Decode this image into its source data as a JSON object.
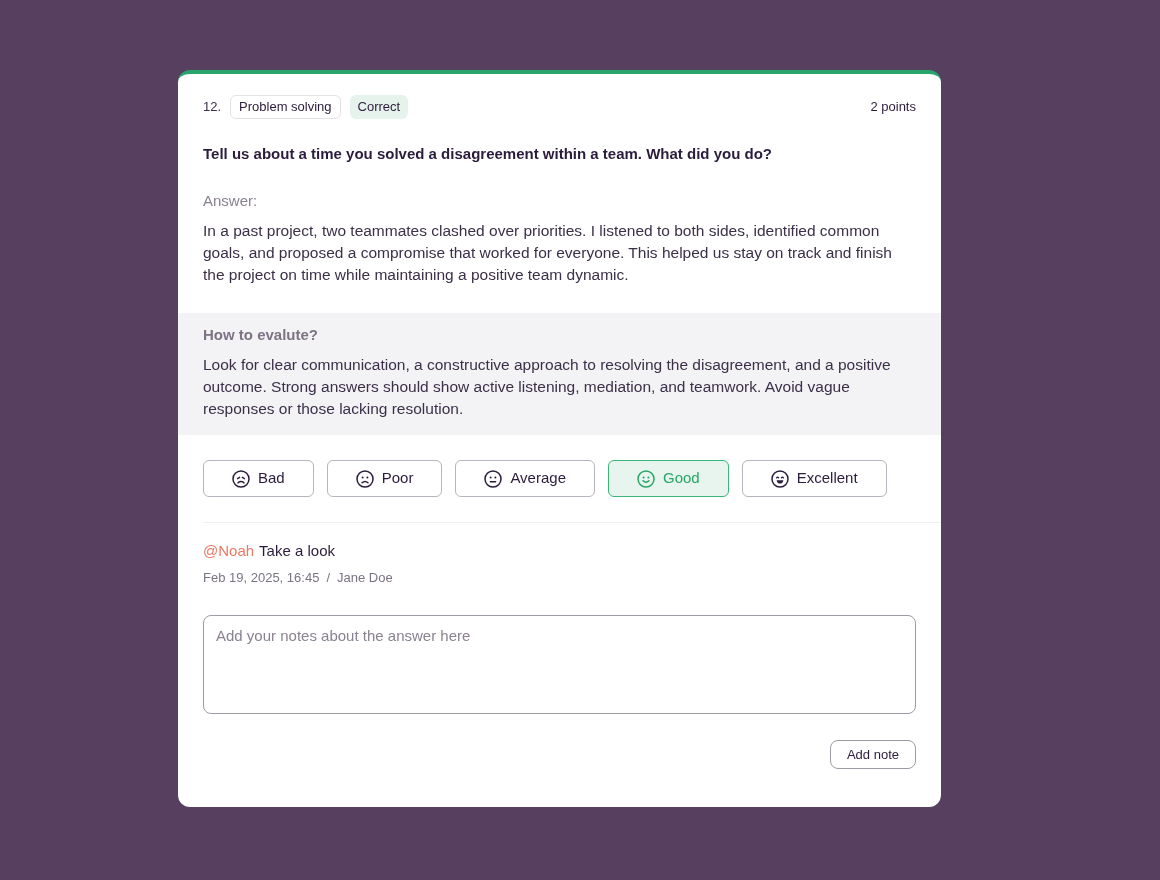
{
  "question": {
    "number": "12.",
    "category": "Problem solving",
    "status": "Correct",
    "points": "2 points",
    "title": "Tell us about a time you solved a disagreement within a team. What did you do?"
  },
  "answer": {
    "label": "Answer:",
    "text": "In a past project, two teammates clashed over priorities. I listened to both sides, identified common goals, and proposed a compromise that worked for everyone. This helped us stay on track and finish the project on time while maintaining a positive team dynamic."
  },
  "evaluation": {
    "title": "How to evalute?",
    "text": "Look for clear communication, a constructive approach to resolving the disagreement, and a positive outcome. Strong answers should show active listening, mediation, and teamwork. Avoid vague responses or those lacking resolution."
  },
  "ratings": [
    {
      "label": "Bad",
      "selected": false
    },
    {
      "label": "Poor",
      "selected": false
    },
    {
      "label": "Average",
      "selected": false
    },
    {
      "label": "Good",
      "selected": true
    },
    {
      "label": "Excellent",
      "selected": false
    }
  ],
  "comment": {
    "mention": "@Noah",
    "text": "Take a look",
    "date": "Feb 19, 2025, 16:45",
    "separator": "/",
    "author": "Jane Doe"
  },
  "notes": {
    "placeholder": "Add your notes about the answer here",
    "button": "Add note"
  }
}
